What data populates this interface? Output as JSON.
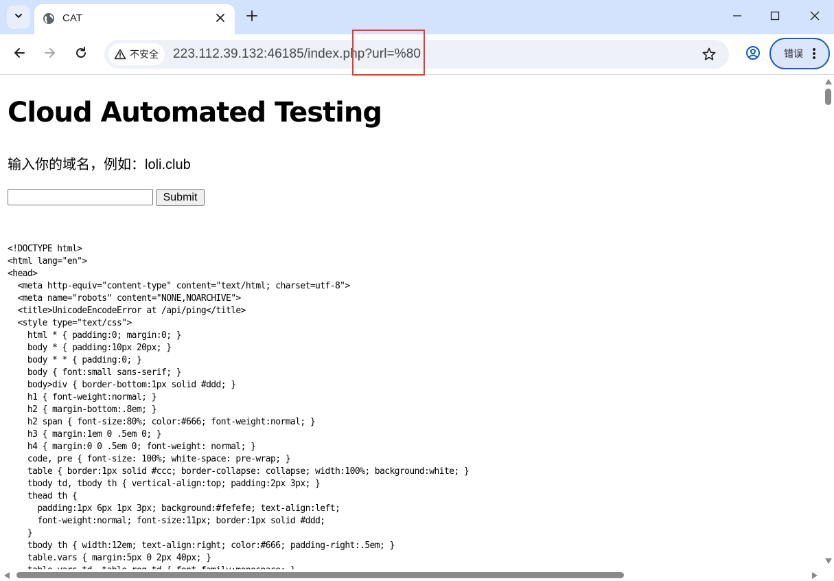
{
  "browser": {
    "tab": {
      "title": "CAT",
      "icon": "globe-icon"
    },
    "omnibox": {
      "security_label": "不安全",
      "url": "223.112.39.132:46185/index.php?url=%80"
    },
    "error_chip_label": "错误"
  },
  "page": {
    "title": "Cloud Automated Testing",
    "prompt": "输入你的域名，例如：loli.club",
    "input_value": "",
    "submit_label": "Submit",
    "source_lines": [
      "<!DOCTYPE html>",
      "<html lang=\"en\">",
      "<head>",
      "  <meta http-equiv=\"content-type\" content=\"text/html; charset=utf-8\">",
      "  <meta name=\"robots\" content=\"NONE,NOARCHIVE\">",
      "  <title>UnicodeEncodeError at /api/ping</title>",
      "  <style type=\"text/css\">",
      "    html * { padding:0; margin:0; }",
      "    body * { padding:10px 20px; }",
      "    body * * { padding:0; }",
      "    body { font:small sans-serif; }",
      "    body>div { border-bottom:1px solid #ddd; }",
      "    h1 { font-weight:normal; }",
      "    h2 { margin-bottom:.8em; }",
      "    h2 span { font-size:80%; color:#666; font-weight:normal; }",
      "    h3 { margin:1em 0 .5em 0; }",
      "    h4 { margin:0 0 .5em 0; font-weight: normal; }",
      "    code, pre { font-size: 100%; white-space: pre-wrap; }",
      "    table { border:1px solid #ccc; border-collapse: collapse; width:100%; background:white; }",
      "    tbody td, tbody th { vertical-align:top; padding:2px 3px; }",
      "    thead th {",
      "      padding:1px 6px 1px 3px; background:#fefefe; text-align:left;",
      "      font-weight:normal; font-size:11px; border:1px solid #ddd;",
      "    }",
      "    tbody th { width:12em; text-align:right; color:#666; padding-right:.5em; }",
      "    table.vars { margin:5px 0 2px 40px; }",
      "    table.vars td, table.req td { font-family:monospace; }"
    ]
  },
  "colors": {
    "tabstrip_bg": "#d3e3fd",
    "omnibox_bg": "#eef1f8",
    "highlight_box": "#e53935",
    "error_chip_border": "#1a5fb4"
  }
}
